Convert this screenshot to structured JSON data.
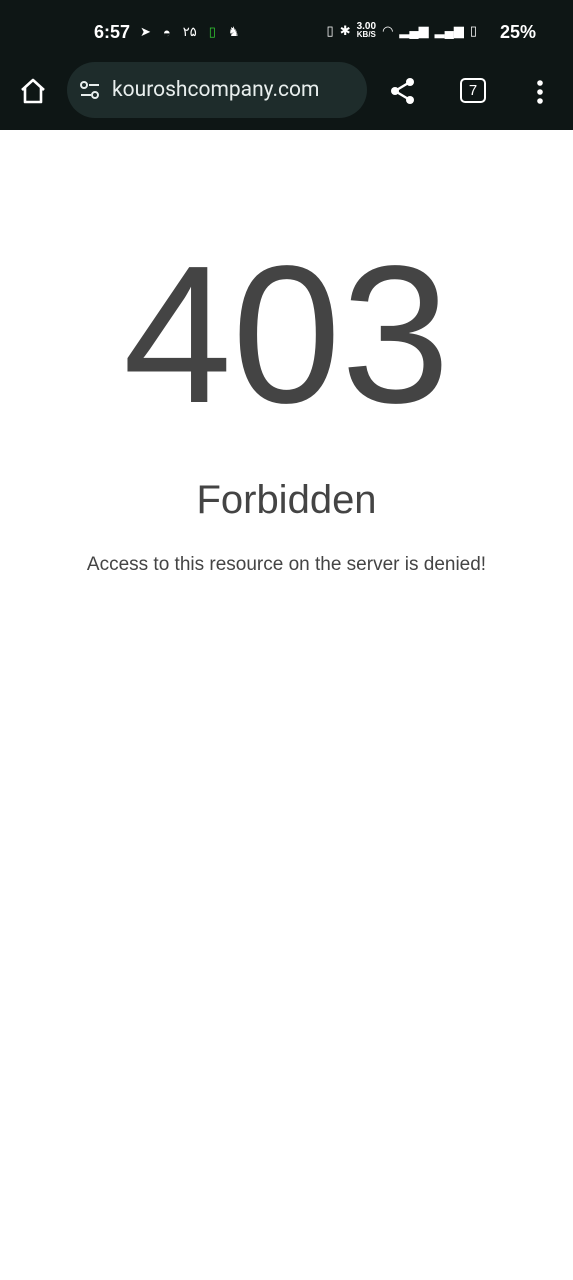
{
  "status_bar": {
    "time": "6:57",
    "notif_text": "۲۵",
    "net_speed": "3.00",
    "net_unit": "KB/S",
    "battery": "25%"
  },
  "browser": {
    "url": "kouroshcompany.com",
    "tab_count": "7"
  },
  "page": {
    "code": "403",
    "title": "Forbidden",
    "message": "Access to this resource on the server is denied!"
  }
}
